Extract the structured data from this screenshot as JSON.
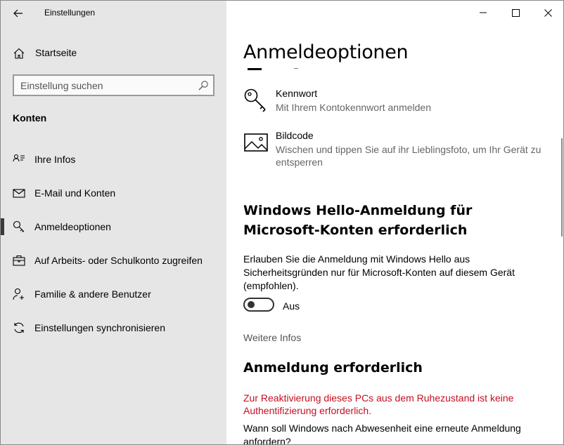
{
  "window": {
    "app_title": "Einstellungen",
    "controls": {
      "minimize": "minimize-icon",
      "maximize": "maximize-icon",
      "close": "close-icon"
    }
  },
  "sidebar": {
    "home_label": "Startseite",
    "search_placeholder": "Einstellung suchen",
    "section_title": "Konten",
    "items": [
      {
        "label": "Ihre Infos",
        "icon": "person-card-icon",
        "selected": false
      },
      {
        "label": "E-Mail und Konten",
        "icon": "mail-icon",
        "selected": false
      },
      {
        "label": "Anmeldeoptionen",
        "icon": "key-icon",
        "selected": true
      },
      {
        "label": "Auf Arbeits- oder Schulkonto zugreifen",
        "icon": "briefcase-icon",
        "selected": false
      },
      {
        "label": "Familie & andere Benutzer",
        "icon": "person-add-icon",
        "selected": false
      },
      {
        "label": "Einstellungen synchronisieren",
        "icon": "sync-icon",
        "selected": false
      }
    ]
  },
  "main": {
    "title": "Anmeldeoptionen",
    "options": [
      {
        "title": "Kennwort",
        "description": "Mit Ihrem Kontokennwort anmelden",
        "icon": "key-icon"
      },
      {
        "title": "Bildcode",
        "description": "Wischen und tippen Sie auf ihr Lieblingsfoto, um Ihr Gerät zu entsperren",
        "icon": "picture-icon"
      }
    ],
    "hello_section": {
      "heading": "Windows Hello-Anmeldung für Microsoft-Konten erforderlich",
      "description": "Erlauben Sie die Anmeldung mit Windows Hello aus Sicherheitsgründen nur für Microsoft-Konten auf diesem Gerät (empfohlen).",
      "toggle_state": "Aus",
      "toggle_on": false,
      "more_info": "Weitere Infos"
    },
    "signin_section": {
      "heading": "Anmeldung erforderlich",
      "warning": "Zur Reaktivierung dieses PCs aus dem Ruhezustand ist keine Authentifizierung erforderlich.",
      "question": "Wann soll Windows nach Abwesenheit eine erneute Anmeldung anfordern?"
    },
    "colors": {
      "warning": "#c50f1f",
      "sidebar_bg": "#e6e6e6",
      "secondary_text": "#666666"
    }
  }
}
